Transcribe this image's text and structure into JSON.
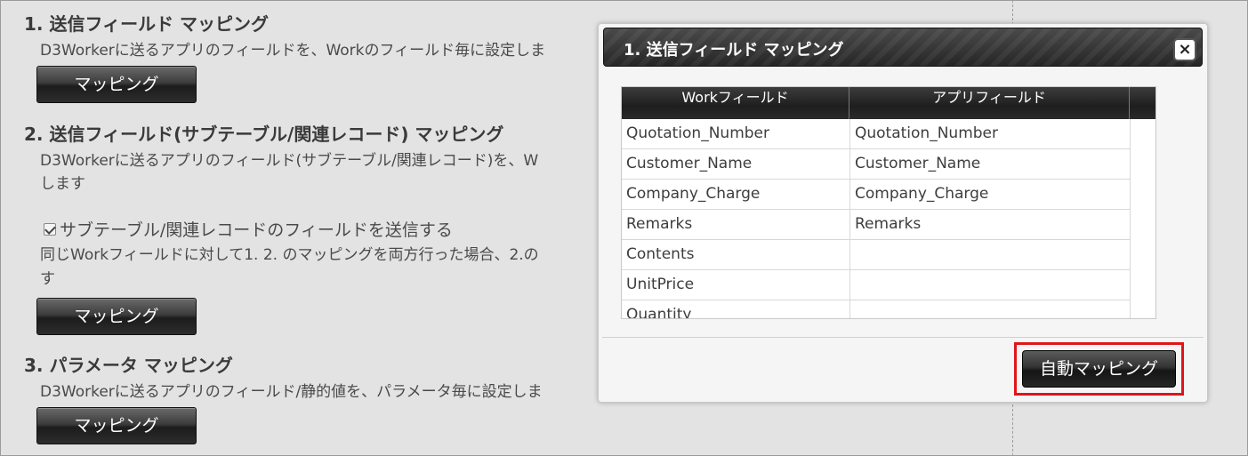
{
  "section1": {
    "title": "1. 送信フィールド マッピング",
    "desc": "D3Workerに送るアプリのフィールドを、Workのフィールド毎に設定しま",
    "button": "マッピング"
  },
  "section2": {
    "title": "2. 送信フィールド(サブテーブル/関連レコード) マッピング",
    "desc_line1": "D3Workerに送るアプリのフィールド(サブテーブル/関連レコード)を、W",
    "desc_line2": "します",
    "checkbox_label": "サブテーブル/関連レコードのフィールドを送信する",
    "checkbox_checked": true,
    "note_line1": "同じWorkフィールドに対して1. 2. のマッピングを両方行った場合、2.の",
    "note_line2": "す",
    "button": "マッピング"
  },
  "section3": {
    "title": "3. パラメータ マッピング",
    "desc": "D3Workerに送るアプリのフィールド/静的値を、パラメータ毎に設定しま",
    "button": "マッピング"
  },
  "modal": {
    "title": "1. 送信フィールド マッピング",
    "close": "×",
    "columns": [
      "Workフィールド",
      "アプリフィールド"
    ],
    "rows": [
      [
        "Quotation_Number",
        "Quotation_Number"
      ],
      [
        "Customer_Name",
        "Customer_Name"
      ],
      [
        "Company_Charge",
        "Company_Charge"
      ],
      [
        "Remarks",
        "Remarks"
      ],
      [
        "Contents",
        ""
      ],
      [
        "UnitPrice",
        ""
      ],
      [
        "Quantity",
        ""
      ]
    ],
    "auto_button": "自動マッピング"
  },
  "colors": {
    "highlight": "#e0151a",
    "background": "#e3e3e3"
  }
}
